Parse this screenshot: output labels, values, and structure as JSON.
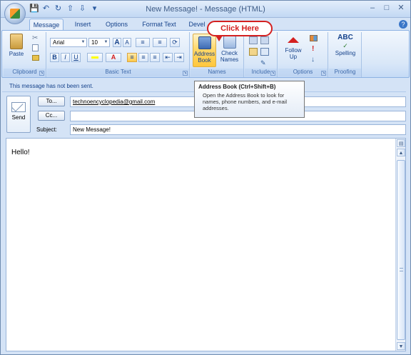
{
  "window": {
    "title": "New Message! - Message (HTML)",
    "controls": [
      "–",
      "□",
      "✕"
    ]
  },
  "qat_icons": [
    "save-icon",
    "undo-icon",
    "redo-icon",
    "up-arrow-icon",
    "down-arrow-icon",
    "customize-icon"
  ],
  "tabs": [
    {
      "label": "Message",
      "active": true
    },
    {
      "label": "Insert",
      "active": false
    },
    {
      "label": "Options",
      "active": false
    },
    {
      "label": "Format Text",
      "active": false
    },
    {
      "label": "Devel",
      "active": false
    }
  ],
  "ribbon": {
    "clipboard": {
      "label": "Clipboard",
      "paste": "Paste"
    },
    "basic_text": {
      "label": "Basic Text",
      "font_name": "Arial",
      "font_size": "10",
      "bold": "B",
      "italic": "I",
      "underline": "U",
      "grow": "A",
      "shrink": "A"
    },
    "names": {
      "label": "Names",
      "address_book": "Address Book",
      "check_names": "Check Names"
    },
    "include": {
      "label": "Include"
    },
    "options": {
      "label": "Options",
      "follow_up": "Follow Up"
    },
    "proofing": {
      "label": "Proofing",
      "spelling": "Spelling",
      "abc": "ABC"
    }
  },
  "callout": {
    "text": "Click Here"
  },
  "tooltip": {
    "title": "Address Book (Ctrl+Shift+B)",
    "description": "Open the Address Book to look for names, phone numbers, and e-mail addresses."
  },
  "infobar": {
    "text": "This message has not been sent."
  },
  "compose": {
    "send": "Send",
    "to_button": "To...",
    "cc_button": "Cc...",
    "subject_label": "Subject:",
    "to_value": "technoencyclopedia@gmail.com",
    "cc_value": "",
    "subject_value": "New Message!",
    "body": "Hello!"
  },
  "colors": {
    "ribbon_bg": "#d4e3f6",
    "callout_red": "#d42020",
    "hover_gold": "#ffd86b"
  }
}
